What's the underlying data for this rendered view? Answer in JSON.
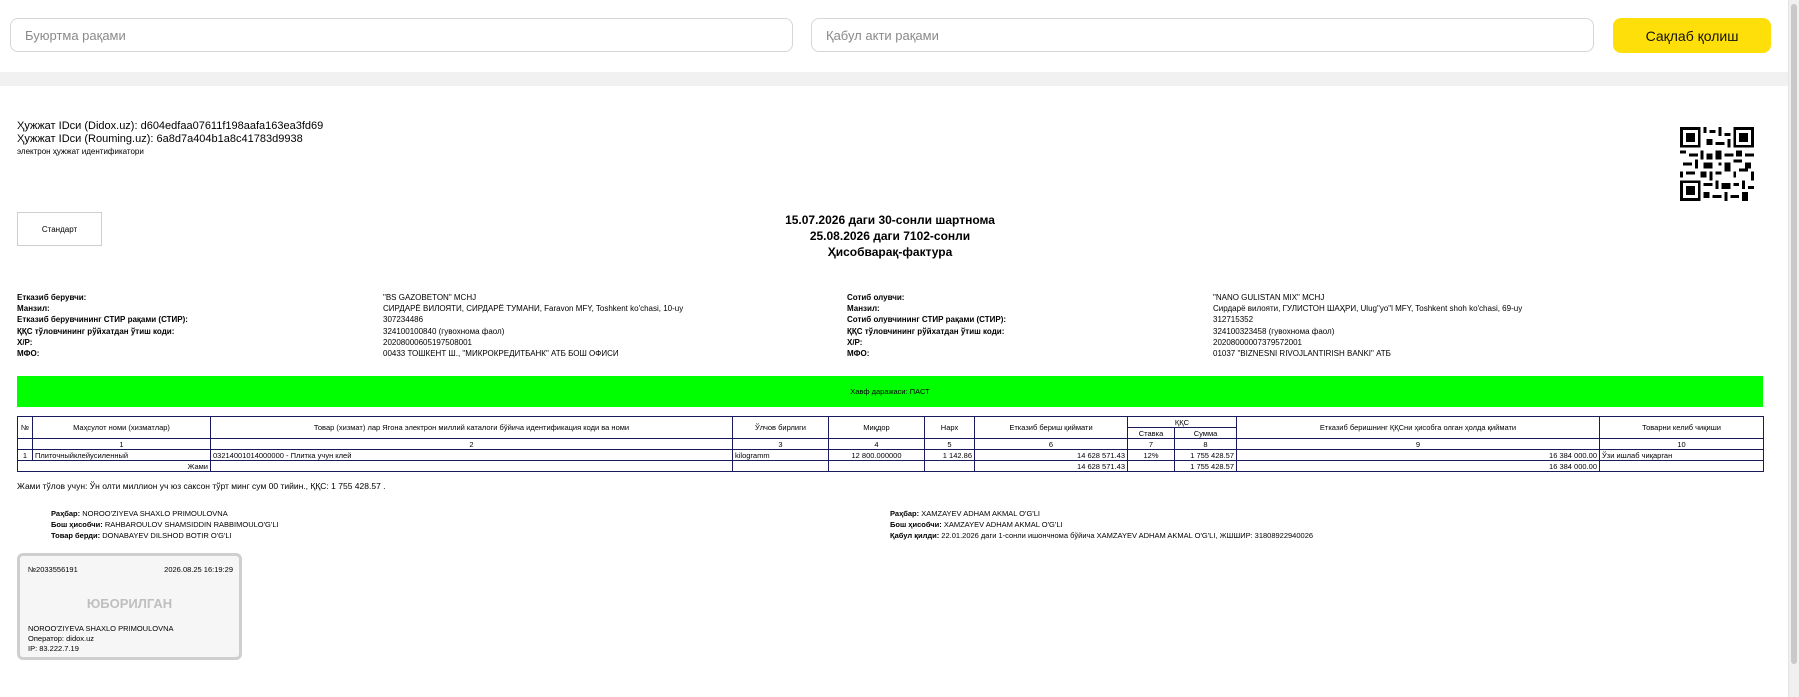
{
  "header": {
    "order_placeholder": "Буюртма рақами",
    "act_placeholder": "Қабул акти рақами",
    "save_label": "Сақлаб қолиш",
    "accent": "#ffdf0a"
  },
  "doc": {
    "id_didox": "Ҳужжат IDси (Didox.uz): d604edfaa07611f198aafa163ea3fd69",
    "id_rouming": "Ҳужжат IDси (Rouming.uz): 6a8d7a404b1a8c41783d9938",
    "id_caption": "электрон ҳужжат идентификатори",
    "standard_label": "Стандарт",
    "title_line1": "15.07.2026 даги 30-сонли шартнома",
    "title_line2": "25.08.2026 даги 7102-сонли",
    "title_line3": "Ҳисобварақ-фактура"
  },
  "seller": {
    "l_name": "Етказиб берувчи:",
    "name": "\"BS GAZOBETON\" MCHJ",
    "l_addr": "Манзил:",
    "addr": "СИРДАРЁ ВИЛОЯТИ, СИРДАРЁ ТУМАНИ, Faravon MFY, Toshkent ko'chasi, 10-uy",
    "l_inn": "Етказиб берувчининг СТИР рақами (СТИР):",
    "inn": "307234486",
    "l_vat": "ҚҚС тўловчининг рўйхатдан ўтиш коди:",
    "vat": "324100100840 (гувохнома фаол)",
    "l_acc": "Х/Р:",
    "acc": "20208000605197508001",
    "l_mfo": "МФО:",
    "mfo": "00433 ТОШКЕНТ Ш., \"МИКРОКРЕДИТБАНК\" АТБ БОШ ОФИСИ"
  },
  "buyer": {
    "l_name": "Сотиб олувчи:",
    "name": "\"NANO GULISTAN MIX\" MCHJ",
    "l_addr": "Манзил:",
    "addr": "Сирдарё вилояти, ГУЛИСТОН ШАҲРИ, Ulug\"yo\"l MFY, Toshkent shoh ko'chasi, 69-uy",
    "l_inn": "Сотиб олувчининг СТИР рақами (СТИР):",
    "inn": "312715352",
    "l_vat": "ҚҚС тўловчининг рўйхатдан ўтиш коди:",
    "vat": "324100323458 (гувохнома фаол)",
    "l_acc": "Х/Р:",
    "acc": "20208000007379572001",
    "l_mfo": "МФО:",
    "mfo": "01037 \"BIZNESNI RIVOJLANTIRISH BANKI\" АТБ"
  },
  "risk": {
    "label": "Хавф даражаси: ПАСТ",
    "color": "#00ff00"
  },
  "table": {
    "h_no": "№",
    "h_name": "Маҳсулот номи (хизматлар)",
    "h_code": "Товар (хизмат) лар Ягона электрон миллий каталоги бўйича идентификация коди ва номи",
    "h_unit": "Ўлчов бирлиги",
    "h_qty": "Миқдор",
    "h_price": "Нарх",
    "h_cost": "Етказиб бериш қиймати",
    "h_vat": "ҚҚС",
    "h_rate": "Ставка",
    "h_sum": "Сумма",
    "h_total": "Етказиб беришнинг ҚҚСни ҳисобга олган ҳолда қиймати",
    "h_origin": "Товарни келиб чиқиши",
    "nums": [
      "1",
      "2",
      "3",
      "4",
      "5",
      "6",
      "7",
      "8",
      "9",
      "10"
    ],
    "row": {
      "no": "1",
      "name": "Плиточныйклейусиленный",
      "code": "03214001014000000 - Плитка учун клей",
      "unit": "kilogramm",
      "qty": "12 800.000000",
      "price": "1 142.86",
      "cost": "14 628 571.43",
      "rate": "12%",
      "sum": "1 755 428.57",
      "total": "16 384 000.00",
      "origin": "Ўзи ишлаб чиқарган"
    },
    "totals": {
      "label": "Жами",
      "cost": "14 628 571.43",
      "sum": "1 755 428.57",
      "total": "16 384 000.00"
    }
  },
  "total_text": "Жами тўлов учун: Ўн олти миллион уч юз саксон тўрт минг сум 00 тийин., ҚҚС: 1 755 428.57 .",
  "signatures": {
    "s_head_l": "Раҳбар:",
    "s_head": "NOROO'ZIYEVA SHAXLO PRIMOULOVNA",
    "s_acc_l": "Бош ҳисобчи:",
    "s_acc": "RAHBAROULOV SHAMSIDDIN RABBIMOULO'G'LI",
    "s_rel_l": "Товар берди:",
    "s_rel": "DONABAYEV DILSHOD BOTIR O'G'LI",
    "b_head_l": "Раҳбар:",
    "b_head": "XAMZAYEV ADHAM AKMAL O'G'LI",
    "b_acc_l": "Бош ҳисобчи:",
    "b_acc": "XAMZAYEV ADHAM AKMAL O'G'LI",
    "b_rec_l": "Қабул қилди:",
    "b_rec": "22.01.2026 даги 1-сонли ишончнома бўйича XAMZAYEV ADHAM AKMAL O'G'LI, ЖШШИР: 31808922940026"
  },
  "stamp": {
    "number": "№2033556191",
    "datetime": "2026.08.25 16:19:29",
    "status": "ЮБОРИЛГАН",
    "signer": "NOROO'ZIYEVA SHAXLO PRIMOULOVNA",
    "operator": "Оператор: didox.uz",
    "ip": "IP: 83.222.7.19"
  }
}
